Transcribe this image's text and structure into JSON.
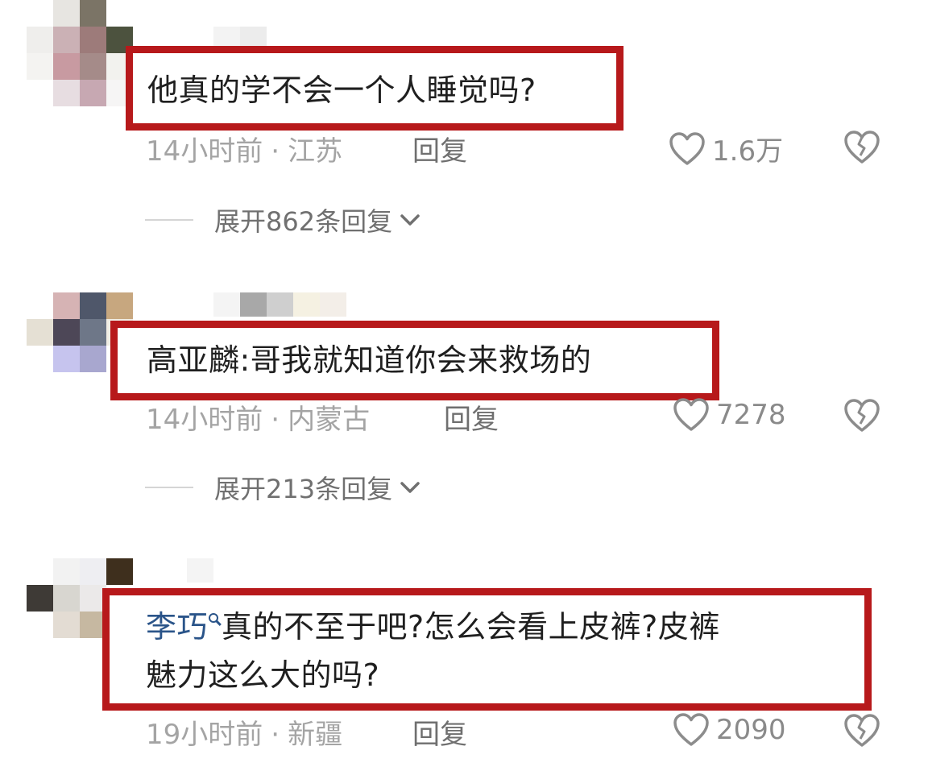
{
  "comments": [
    {
      "text": "他真的学不会一个人睡觉吗?",
      "time": "14小时前",
      "location": "江苏",
      "reply_label": "回复",
      "likes": "1.6万",
      "expand_label": "展开862条回复"
    },
    {
      "text": "高亚麟:哥我就知道你会来救场的",
      "time": "14小时前",
      "location": "内蒙古",
      "reply_label": "回复",
      "likes": "7278",
      "expand_label": "展开213条回复"
    },
    {
      "mention": "李巧",
      "text_line1": "真的不至于吧?怎么会看上皮裤?皮裤",
      "text_line2": "魅力这么大的吗?",
      "time": "19小时前",
      "location": "新疆",
      "reply_label": "回复",
      "likes": "2090"
    }
  ],
  "separator": "·",
  "colors": {
    "highlight_border": "#b7191b",
    "mention": "#2a5489",
    "meta": "#a4a4a4"
  },
  "icons": [
    "heart-outline-icon",
    "broken-heart-icon",
    "chevron-down-icon",
    "search-mention-icon"
  ]
}
